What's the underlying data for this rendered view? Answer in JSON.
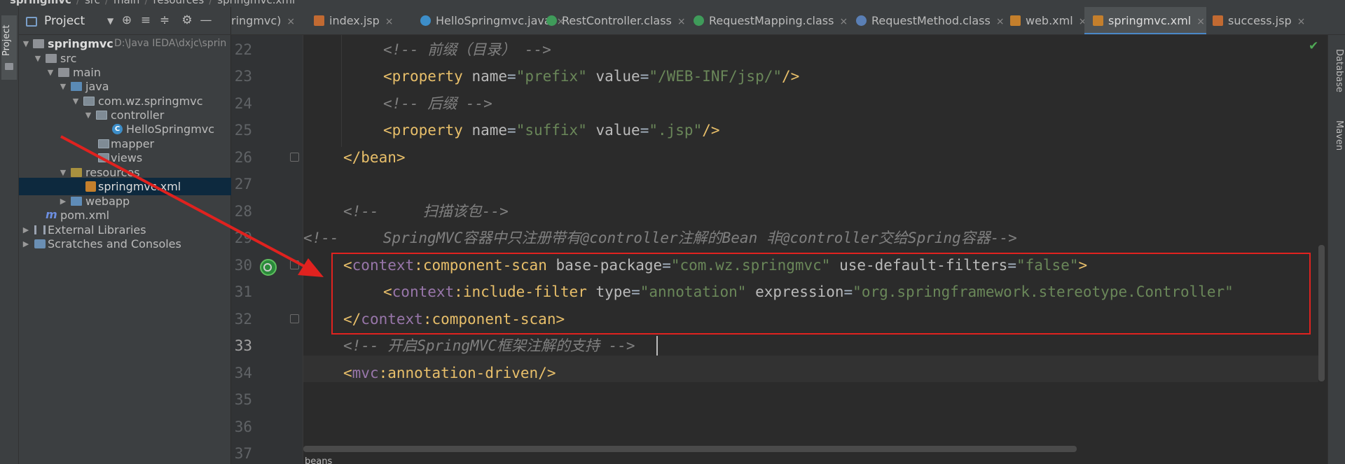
{
  "breadcrumb": {
    "root": "springmvc",
    "items": [
      "src",
      "main",
      "resources",
      "springmvc.xml"
    ]
  },
  "left_stripe": {
    "label": "Project"
  },
  "project_panel": {
    "title": "Project",
    "caret": "▼",
    "toolbar_icons": [
      "⊕",
      "≡",
      "≑",
      "⚙",
      "—"
    ],
    "tree": [
      {
        "label": "springmvc",
        "path": "D:\\Java IEDA\\dxjc\\sprin",
        "expanded": true
      },
      {
        "label": "src",
        "expanded": true
      },
      {
        "label": "main",
        "expanded": true
      },
      {
        "label": "java",
        "expanded": true
      },
      {
        "label": "com.wz.springmvc",
        "expanded": true
      },
      {
        "label": "controller",
        "expanded": true
      },
      {
        "label": "HelloSpringmvc",
        "class_letter": "C"
      },
      {
        "label": "mapper"
      },
      {
        "label": "views"
      },
      {
        "label": "resources",
        "expanded": true
      },
      {
        "label": "springmvc.xml"
      },
      {
        "label": "webapp",
        "expanded": false
      },
      {
        "label": "pom.xml",
        "maven_letter": "m"
      },
      {
        "label": "External Libraries",
        "expanded": false
      },
      {
        "label": "Scratches and Consoles",
        "expanded": false
      }
    ]
  },
  "tabs": [
    {
      "label": "ringmvc)",
      "closable": true
    },
    {
      "label": "index.jsp",
      "closable": true
    },
    {
      "label": "HelloSpringmvc.java",
      "closable": true
    },
    {
      "label": "RestController.class",
      "closable": true
    },
    {
      "label": "RequestMapping.class",
      "closable": true
    },
    {
      "label": "RequestMethod.class",
      "closable": true
    },
    {
      "label": "web.xml",
      "closable": true
    },
    {
      "label": "springmvc.xml",
      "closable": true,
      "active": true
    },
    {
      "label": "success.jsp",
      "closable": true
    }
  ],
  "tab_close_glyph": "×",
  "right_stripe": [
    "Database",
    "Maven"
  ],
  "editor": {
    "current_line": "33",
    "line_numbers": [
      "22",
      "23",
      "24",
      "25",
      "26",
      "27",
      "28",
      "29",
      "30",
      "31",
      "32",
      "33",
      "34",
      "35",
      "36",
      "37"
    ],
    "code": {
      "l22_comment": "<!-- 前缀（目录） -->",
      "l23_open": "<",
      "l23_tag": "property",
      "l23_a1": " name",
      "l23_eq": "=",
      "l23_v1": "\"prefix\"",
      "l23_a2": " value",
      "l23_v2": "\"/WEB-INF/jsp/\"",
      "l23_close": "/>",
      "l24_comment": "<!-- 后缀 -->",
      "l25_v1": "\"suffix\"",
      "l25_v2": "\".jsp\"",
      "l26": "</bean>",
      "l28_comment": "<!--     扫描该包-->",
      "l29_comment": "<!--     SpringMVC容器中只注册带有@controller注解的Bean 非@controller交给Spring容器-->",
      "l30_ns": "context",
      "l30_colon": ":",
      "l30_tag": "component-scan",
      "l30_a1": " base-package",
      "l30_v1": "\"com.wz.springmvc\"",
      "l30_a2": " use-default-filters",
      "l30_v2": "\"false\"",
      "l30_close": ">",
      "l31_tag": "include-filter",
      "l31_a1": " type",
      "l31_v1": "\"annotation\"",
      "l31_a2": " expression",
      "l31_v2": "\"org.springframework.stereotype.Controller\"",
      "l32_open": "</",
      "l33_comment": "<!-- 开启SpringMVC框架注解的支持 -->",
      "l34_ns": "mvc",
      "l34_tag": "annotation-driven"
    },
    "bottom_breadcrumb": "beans"
  },
  "colors": {
    "highlight_box": "#e0221f",
    "annotation_arrow": "#e0221f",
    "active_tab_underline": "#4a88c7"
  },
  "icons": {
    "check": "✔",
    "gear": "⚙",
    "lightbulb": "lightbulb-icon",
    "spring_bean": "spring-bean-icon"
  }
}
